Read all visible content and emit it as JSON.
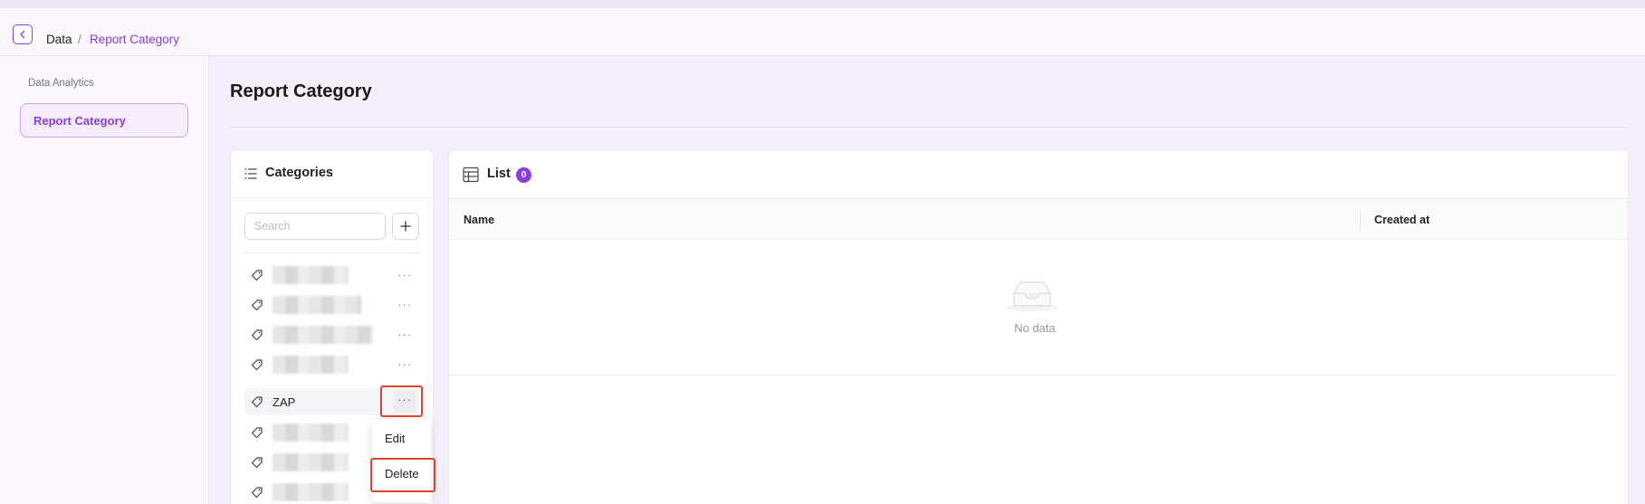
{
  "breadcrumb": {
    "root": "Data",
    "separator": "/",
    "current": "Report Category"
  },
  "sidebar": {
    "group_label": "Data Analytics",
    "items": [
      {
        "label": "Report Category",
        "active": true
      }
    ]
  },
  "page": {
    "title": "Report Category"
  },
  "categories": {
    "title": "Categories",
    "search_placeholder": "Search",
    "add_icon": "plus-icon",
    "items": [
      {
        "label": "",
        "redacted": true
      },
      {
        "label": "",
        "redacted": true
      },
      {
        "label": "",
        "redacted": true
      },
      {
        "label": "",
        "redacted": true
      },
      {
        "label": "ZAP",
        "redacted": false,
        "active": true
      },
      {
        "label": "",
        "redacted": true
      },
      {
        "label": "",
        "redacted": true
      },
      {
        "label": "",
        "redacted": true
      }
    ],
    "more_label": "···",
    "menu": {
      "edit": "Edit",
      "delete": "Delete"
    }
  },
  "list": {
    "title": "List",
    "count": "0",
    "columns": {
      "name": "Name",
      "created_at": "Created at"
    },
    "empty_text": "No data"
  },
  "colors": {
    "accent": "#8b3ddb",
    "highlight": "#e2432f"
  }
}
